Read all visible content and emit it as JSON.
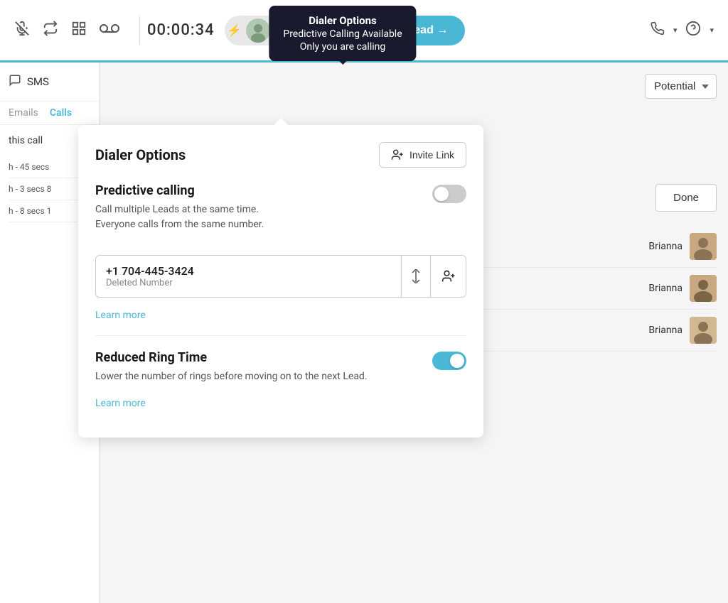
{
  "tooltip": {
    "title": "Dialer Options",
    "line1": "Predictive Calling Available",
    "line2": "Only you are calling"
  },
  "toolbar": {
    "timer": "00:00:34",
    "call_next_label": "Call Next Lead →",
    "mute_icon": "🎤",
    "transfer_icon": "⇅",
    "grid_icon": "⊞",
    "voicemail_icon": "∞"
  },
  "panel": {
    "title": "Dialer Options",
    "invite_btn_label": "Invite Link",
    "predictive_title": "Predictive calling",
    "predictive_desc_line1": "Call multiple Leads at the same time.",
    "predictive_desc_line2": "Everyone calls from the same number.",
    "predictive_toggle": false,
    "phone_number": "+1 704-445-3424",
    "phone_label": "Deleted Number",
    "learn_more_1": "Learn more",
    "reduced_title": "Reduced Ring Time",
    "reduced_desc": "Lower the number of rings before moving on to the next Lead.",
    "reduced_toggle": true,
    "learn_more_2": "Learn more"
  },
  "left_panel": {
    "sms_label": "SMS",
    "tabs": [
      {
        "label": "Emails",
        "active": false
      },
      {
        "label": "Calls",
        "active": true
      }
    ],
    "this_call_label": "this call",
    "list_items": [
      {
        "text": "h - 45 secs"
      },
      {
        "text": "h - 3 secs 8"
      },
      {
        "text": "h - 8 secs 1"
      }
    ]
  },
  "right_panel": {
    "potential_label": "Potential",
    "done_label": "Done",
    "list_items": [
      {
        "name": "Brianna",
        "meta": ""
      },
      {
        "name": "Brianna",
        "meta": ""
      },
      {
        "name": "Brianna",
        "meta": ""
      }
    ]
  },
  "header_right": {
    "phone_label": "📞",
    "question_label": "?"
  }
}
